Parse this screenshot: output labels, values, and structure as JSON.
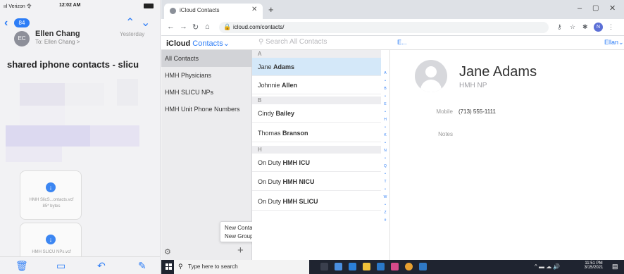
{
  "phone": {
    "status_time": "12:02 AM",
    "status_signal": "ııl Verizon 令",
    "back_badge": "84",
    "sender": "Ellen Chang",
    "to": "To: Ellen Chang >",
    "date": "Yesterday",
    "avatar_initials": "EC",
    "subject": "shared iphone contacts - slicu",
    "attachments": [
      {
        "name": "HMH SlicS...ontacts.vcf",
        "size": "85* bytes"
      },
      {
        "name": "HMH SLICU NPs.vcf",
        "size": ""
      }
    ]
  },
  "browser": {
    "tab_title": "iCloud Contacts",
    "url": "icloud.com/contacts/",
    "profile_initial": "N"
  },
  "icloud": {
    "brand": "iCloud",
    "app": "Contacts",
    "search_placeholder": "Search All Contacts",
    "edit_label": "E...",
    "user_label": "Ellan",
    "groups": [
      "All Contacts",
      "HMH Physicians",
      "HMH SLICU NPs",
      "HMH Unit Phone Numbers"
    ],
    "popup": [
      "New Contact",
      "New Group"
    ],
    "sections": {
      "a": "A",
      "b": "B",
      "h": "H"
    },
    "contacts": [
      {
        "first": "Jane",
        "last": "Adams"
      },
      {
        "first": "Johnnie",
        "last": "Allen"
      },
      {
        "first": "Cindy",
        "last": "Bailey"
      },
      {
        "first": "Thomas",
        "last": "Branson"
      },
      {
        "first": "On Duty",
        "last": "HMH ICU"
      },
      {
        "first": "On Duty",
        "last": "HMH NICU"
      },
      {
        "first": "On Duty",
        "last": "HMH SLICU"
      }
    ],
    "index_letters": [
      "A",
      "•",
      "B",
      "•",
      "E",
      "•",
      "H",
      "•",
      "K",
      "•",
      "N",
      "•",
      "Q",
      "•",
      "T",
      "•",
      "W",
      "•",
      "Z",
      "#"
    ],
    "detail": {
      "name": "Jane Adams",
      "title": "HMH NP",
      "mobile_label": "Mobile",
      "mobile_value": "(713) 555-1111",
      "notes_label": "Notes"
    }
  },
  "taskbar": {
    "search_placeholder": "Type here to search",
    "time": "11:51 PM",
    "date": "3/15/2021"
  }
}
